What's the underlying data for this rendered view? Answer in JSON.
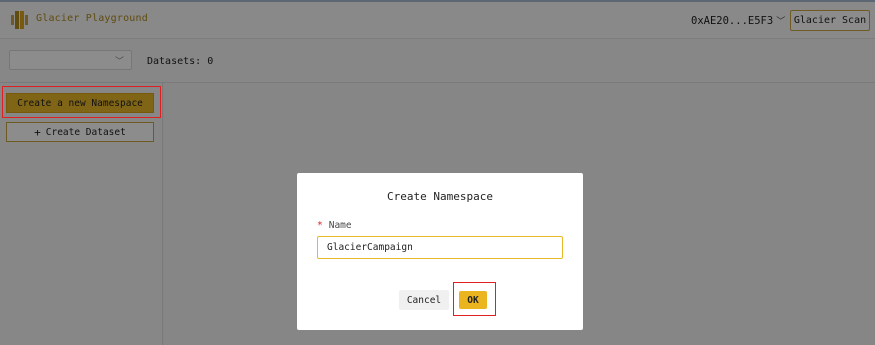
{
  "header": {
    "app_name": "Glacier Playground",
    "account": "0xAE20...E5F3",
    "scan_button": "Glacier Scan",
    "logo_icon": "glacier-logo-icon"
  },
  "toolbar": {
    "namespace_select_value": "",
    "datasets_label": "Datasets: 0"
  },
  "sidebar": {
    "create_namespace": "Create a new Namespace",
    "create_dataset": "Create Dataset"
  },
  "modal": {
    "title": "Create Namespace",
    "required_mark": "*",
    "field_label": "Name",
    "field_value": "GlacierCampaign",
    "cancel": "Cancel",
    "ok": "OK"
  },
  "colors": {
    "accent": "#e9b92a",
    "highlight": "#e02020",
    "overlay": "rgba(0,0,0,0.45)"
  }
}
